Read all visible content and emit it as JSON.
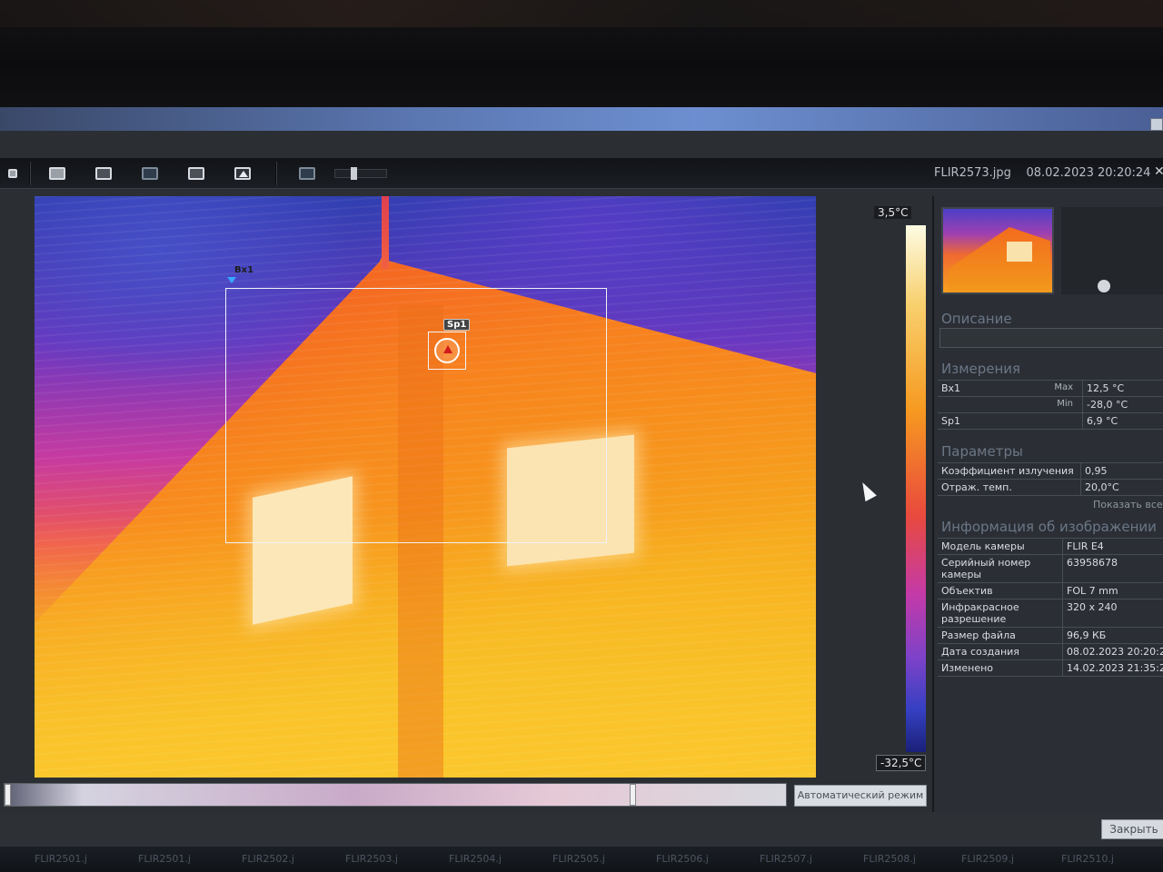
{
  "toolbar": {
    "file_name": "FLIR2573.jpg",
    "datetime": "08.02.2023 20:20:24",
    "close_label": "✕"
  },
  "image": {
    "box_label": "Bx1",
    "spot_label": "Sp1"
  },
  "scale": {
    "max": "3,5°C",
    "min": "-32,5°C"
  },
  "bottom": {
    "auto_mode": "Автоматический режим"
  },
  "panel": {
    "description_title": "Описание",
    "measurements_title": "Измерения",
    "measurements": [
      {
        "name": "Bx1",
        "sub": "Max",
        "value": "12,5 °C"
      },
      {
        "name": "",
        "sub": "Min",
        "value": "-28,0 °C"
      },
      {
        "name": "Sp1",
        "sub": "",
        "value": "6,9 °C"
      }
    ],
    "params_title": "Параметры",
    "params": [
      {
        "name": "Коэффициент излучения",
        "value": "0,95"
      },
      {
        "name": "Отраж. темп.",
        "value": "20,0°C"
      }
    ],
    "show_all": "Показать все",
    "info_title": "Информация об изображении",
    "info": [
      {
        "name": "Модель камеры",
        "value": "FLIR E4"
      },
      {
        "name": "Серийный номер камеры",
        "value": "63958678"
      },
      {
        "name": "Объектив",
        "value": "FOL 7 mm"
      },
      {
        "name": "Инфракрасное разрешение",
        "value": "320 x 240"
      },
      {
        "name": "Размер файла",
        "value": "96,9 КБ"
      },
      {
        "name": "Дата создания",
        "value": "08.02.2023 20:20:2"
      },
      {
        "name": "Изменено",
        "value": "14.02.2023 21:35:2"
      }
    ]
  },
  "footer": {
    "close_button": "Закрыть"
  },
  "taskbar": {
    "items": [
      "FLIR2501.j",
      "FLIR2501.j",
      "FLIR2502.j",
      "FLIR2503.j",
      "FLIR2504.j",
      "FLIR2505.j",
      "FLIR2506.j",
      "FLIR2507.j",
      "FLIR2508.j",
      "FLIR2509.j",
      "FLIR2510.j"
    ]
  }
}
